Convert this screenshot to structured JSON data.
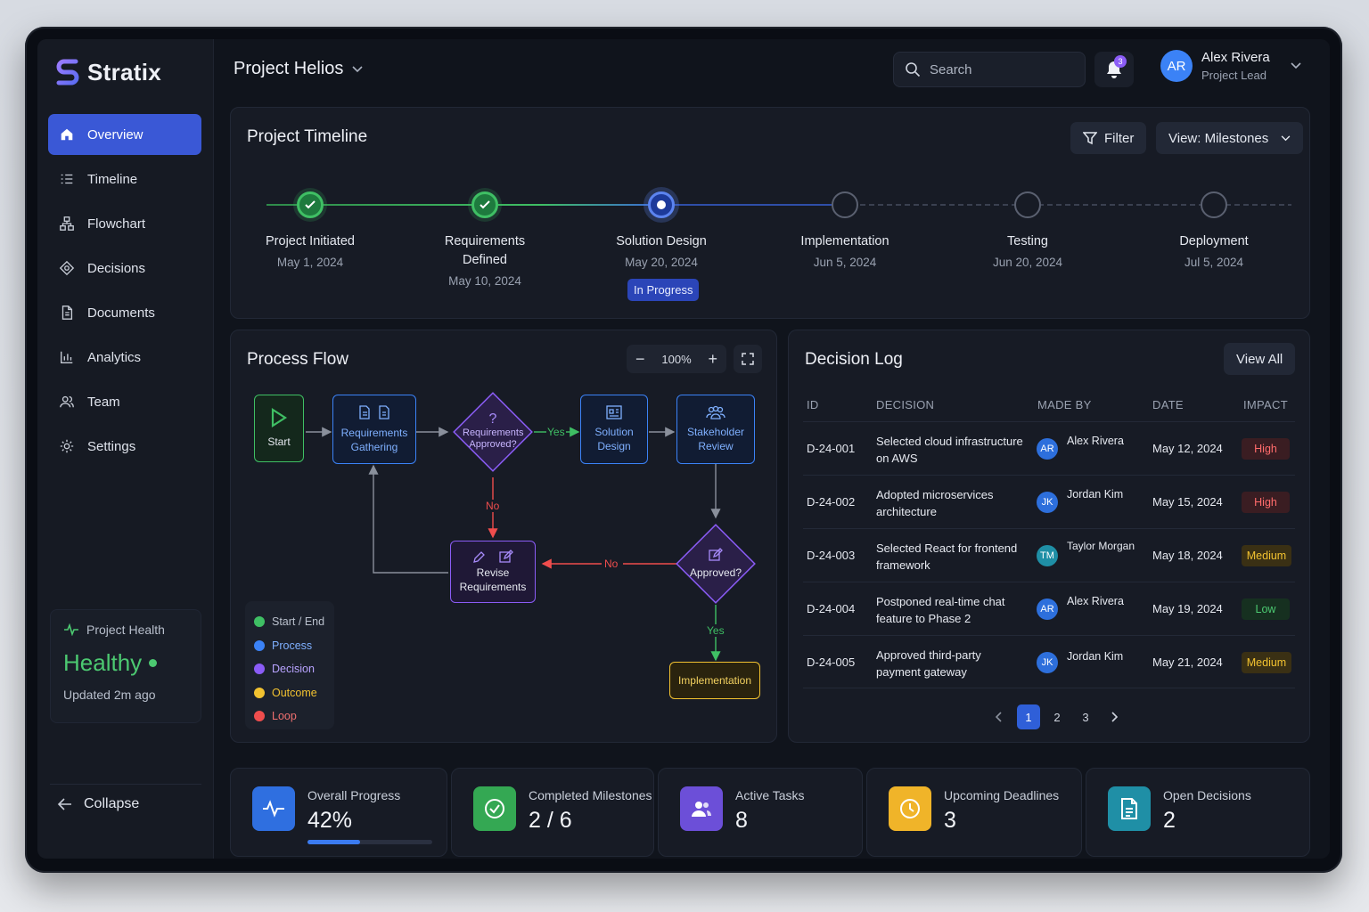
{
  "app": {
    "name": "Stratix",
    "brand_color": "#7b6cf6"
  },
  "sidebar": {
    "items": [
      {
        "label": "Overview",
        "icon": "home-icon",
        "active": true
      },
      {
        "label": "Timeline",
        "icon": "list-icon"
      },
      {
        "label": "Flowchart",
        "icon": "flowchart-icon"
      },
      {
        "label": "Decisions",
        "icon": "decision-icon"
      },
      {
        "label": "Documents",
        "icon": "document-icon"
      },
      {
        "label": "Analytics",
        "icon": "chart-icon"
      },
      {
        "label": "Team",
        "icon": "team-icon"
      },
      {
        "label": "Settings",
        "icon": "gear-icon"
      }
    ],
    "health": {
      "title": "Project Health",
      "status": "Healthy",
      "updated": "Updated 2m ago"
    },
    "collapse_label": "Collapse"
  },
  "header": {
    "project": "Project Helios",
    "search_placeholder": "Search",
    "notification_count": "3",
    "user": {
      "initials": "AR",
      "name": "Alex Rivera",
      "role": "Project Lead"
    }
  },
  "timeline": {
    "title": "Project Timeline",
    "filter_label": "Filter",
    "view_label": "View: Milestones",
    "milestones": [
      {
        "name": "Project Initiated",
        "date": "May 1, 2024",
        "status": "done"
      },
      {
        "name": "Requirements Defined",
        "date": "May 10, 2024",
        "status": "done"
      },
      {
        "name": "Solution Design",
        "date": "May 20, 2024",
        "status": "current",
        "badge": "In Progress"
      },
      {
        "name": "Implementation",
        "date": "Jun 5, 2024",
        "status": "pending"
      },
      {
        "name": "Testing",
        "date": "Jun 20, 2024",
        "status": "pending"
      },
      {
        "name": "Deployment",
        "date": "Jul 5, 2024",
        "status": "pending"
      }
    ]
  },
  "process_flow": {
    "title": "Process Flow",
    "zoom": "100%",
    "nodes": {
      "start": "Start",
      "requirements_gathering": "Requirements Gathering",
      "requirements_approved": "Requirements Approved?",
      "solution_design": "Solution Design",
      "stakeholder_review": "Stakeholder Review",
      "revise_requirements": "Revise Requirements",
      "approved": "Approved?",
      "implementation": "Implementation"
    },
    "edge_labels": {
      "yes1": "Yes",
      "no1": "No",
      "no2": "No",
      "yes2": "Yes"
    },
    "legend": [
      {
        "label": "Start / End",
        "color": "#3fbf64"
      },
      {
        "label": "Process",
        "color": "#3b82f6"
      },
      {
        "label": "Decision",
        "color": "#8b5cf6"
      },
      {
        "label": "Outcome",
        "color": "#f2c230"
      },
      {
        "label": "Loop",
        "color": "#ef4d4d"
      }
    ]
  },
  "decision_log": {
    "title": "Decision Log",
    "view_all_label": "View All",
    "columns": [
      "ID",
      "DECISION",
      "MADE BY",
      "DATE",
      "IMPACT"
    ],
    "rows": [
      {
        "id": "D-24-001",
        "decision": "Selected cloud infrastructure on AWS",
        "initials": "AR",
        "made_by": "Alex Rivera",
        "date": "May 12, 2024",
        "impact": "High"
      },
      {
        "id": "D-24-002",
        "decision": "Adopted microservices architecture",
        "initials": "JK",
        "made_by": "Jordan Kim",
        "date": "May 15, 2024",
        "impact": "High"
      },
      {
        "id": "D-24-003",
        "decision": "Selected React for frontend framework",
        "initials": "TM",
        "made_by": "Taylor Morgan",
        "date": "May 18, 2024",
        "impact": "Medium"
      },
      {
        "id": "D-24-004",
        "decision": "Postponed real-time chat feature to Phase 2",
        "initials": "AR",
        "made_by": "Alex Rivera",
        "date": "May 19, 2024",
        "impact": "Low"
      },
      {
        "id": "D-24-005",
        "decision": "Approved third-party payment gateway",
        "initials": "JK",
        "made_by": "Jordan Kim",
        "date": "May 21, 2024",
        "impact": "Medium"
      }
    ],
    "pages": [
      "1",
      "2",
      "3"
    ],
    "current_page": "1"
  },
  "stats": [
    {
      "label": "Overall Progress",
      "value": "42%",
      "progress": 0.42,
      "icon": "activity-icon",
      "color": "#2f6fe0"
    },
    {
      "label": "Completed Milestones",
      "value": "2 / 6",
      "icon": "check-circle-icon",
      "color": "#34a853"
    },
    {
      "label": "Active Tasks",
      "value": "8",
      "icon": "users-icon",
      "color": "#6c4fd8"
    },
    {
      "label": "Upcoming Deadlines",
      "value": "3",
      "icon": "clock-icon",
      "color": "#f0b429"
    },
    {
      "label": "Open Decisions",
      "value": "2",
      "icon": "file-icon",
      "color": "#1f8fa6"
    }
  ]
}
